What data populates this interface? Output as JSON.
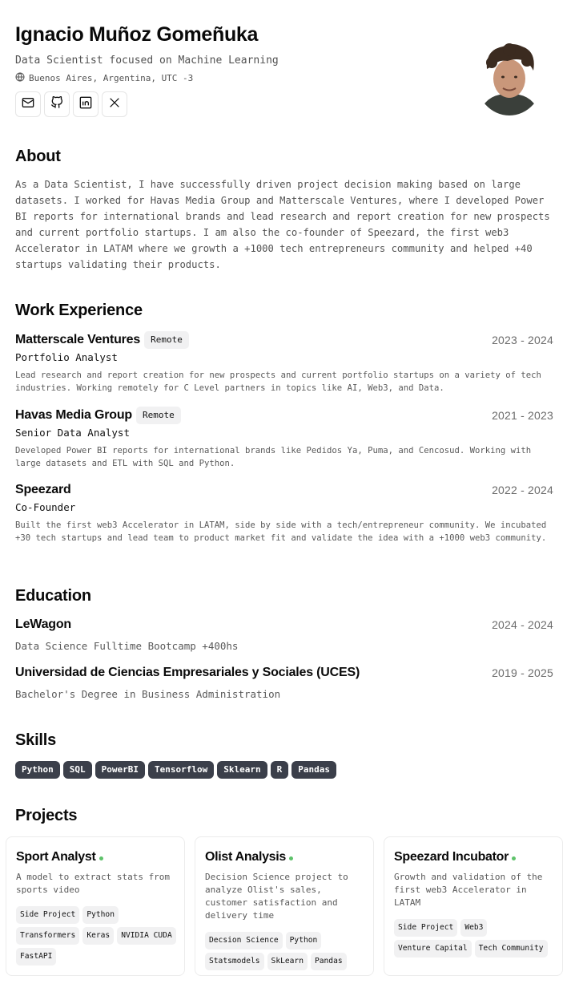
{
  "header": {
    "name": "Ignacio Muñoz Gomeñuka",
    "tagline": "Data Scientist focused on Machine Learning",
    "location": "Buenos Aires, Argentina, UTC -3",
    "socials": [
      "email",
      "github",
      "linkedin",
      "x"
    ]
  },
  "about": {
    "title": "About",
    "text": "As a Data Scientist, I have successfully driven project decision making based on large datasets. I worked for Havas Media Group and Matterscale Ventures, where I developed Power BI reports for international brands and lead research and report creation for new prospects and current portfolio startups. I am also the co-founder of Speezard, the first web3 Accelerator in LATAM where we growth a +1000 tech entrepreneurs community and helped +40 startups validating their products."
  },
  "work": {
    "title": "Work Experience",
    "jobs": [
      {
        "company": "Matterscale Ventures",
        "badge": "Remote",
        "dates": "2023 - 2024",
        "role": "Portfolio Analyst",
        "description": "Lead research and report creation for new prospects and current portfolio startups on a variety of tech industries. Working remotely for C Level partners in topics like AI, Web3, and Data."
      },
      {
        "company": "Havas Media Group",
        "badge": "Remote",
        "dates": "2021 - 2023",
        "role": "Senior Data Analyst",
        "description": "Developed Power BI reports for international brands like Pedidos Ya, Puma, and Cencosud. Working with large datasets and ETL with SQL and Python."
      },
      {
        "company": "Speezard",
        "badge": "",
        "dates": "2022 - 2024",
        "role": "Co-Founder",
        "description": "Built the first web3 Accelerator in LATAM, side by side with a tech/entrepreneur community. We incubated +30 tech startups and lead team to product market fit and validate the idea with a +1000 web3 community."
      }
    ]
  },
  "education": {
    "title": "Education",
    "items": [
      {
        "school": "LeWagon",
        "dates": "2024 - 2024",
        "degree": "Data Science Fulltime Bootcamp +400hs"
      },
      {
        "school": "Universidad de Ciencias Empresariales y Sociales (UCES)",
        "dates": "2019 - 2025",
        "degree": "Bachelor's Degree in Business Administration"
      }
    ]
  },
  "skills": {
    "title": "Skills",
    "items": [
      "Python",
      "SQL",
      "PowerBI",
      "Tensorflow",
      "Sklearn",
      "R",
      "Pandas"
    ]
  },
  "projects": {
    "title": "Projects",
    "items": [
      {
        "title": "Sport Analyst",
        "description": "A model to extract stats from sports video",
        "tags": [
          "Side Project",
          "Python",
          "Transformers",
          "Keras",
          "NVIDIA CUDA",
          "FastAPI"
        ]
      },
      {
        "title": "Olist Analysis",
        "description": "Decision Science project to analyze Olist's sales, customer satisfaction and delivery time",
        "tags": [
          "Decsion Science",
          "Python",
          "Statsmodels",
          "SkLearn",
          "Pandas"
        ]
      },
      {
        "title": "Speezard Incubator",
        "description": "Growth and validation of the first web3 Accelerator in LATAM",
        "tags": [
          "Side Project",
          "Web3",
          "Venture Capital",
          "Tech Community"
        ]
      }
    ]
  },
  "colors": {
    "text": "#0a0a0a",
    "muted": "#525252",
    "skill_bg": "#3b3f4a",
    "tag_bg": "#f1f1f2",
    "status_dot": "#5ec26a"
  }
}
